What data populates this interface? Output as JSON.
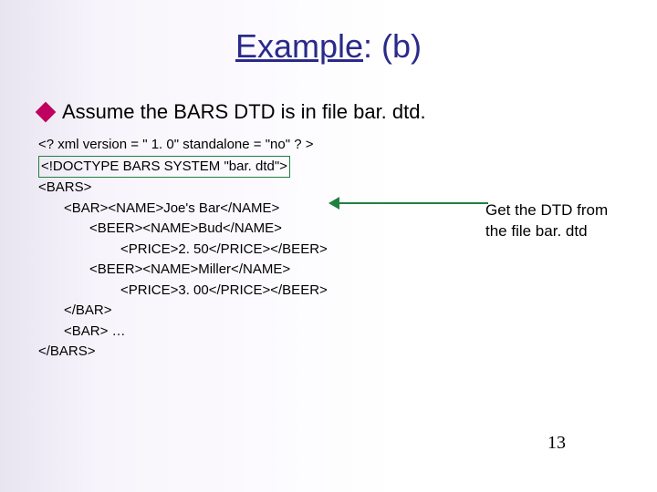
{
  "title": {
    "underlined": "Example",
    "rest": ": (b)"
  },
  "bullet": "Assume the BARS DTD is in file bar. dtd.",
  "code": {
    "l1": "<? xml version = \" 1. 0\" standalone = \"no\" ? >",
    "l2": "<!DOCTYPE BARS SYSTEM \"bar. dtd\">",
    "l3": "<BARS>",
    "l4": "<BAR><NAME>Joe's Bar</NAME>",
    "l5": "<BEER><NAME>Bud</NAME>",
    "l6": "<PRICE>2. 50</PRICE></BEER>",
    "l7": "<BEER><NAME>Miller</NAME>",
    "l8": "<PRICE>3. 00</PRICE></BEER>",
    "l9": "</BAR>",
    "l10": "<BAR> …",
    "l11": "</BARS>"
  },
  "annotation": "Get the DTD from the file bar. dtd",
  "page_number": "13"
}
